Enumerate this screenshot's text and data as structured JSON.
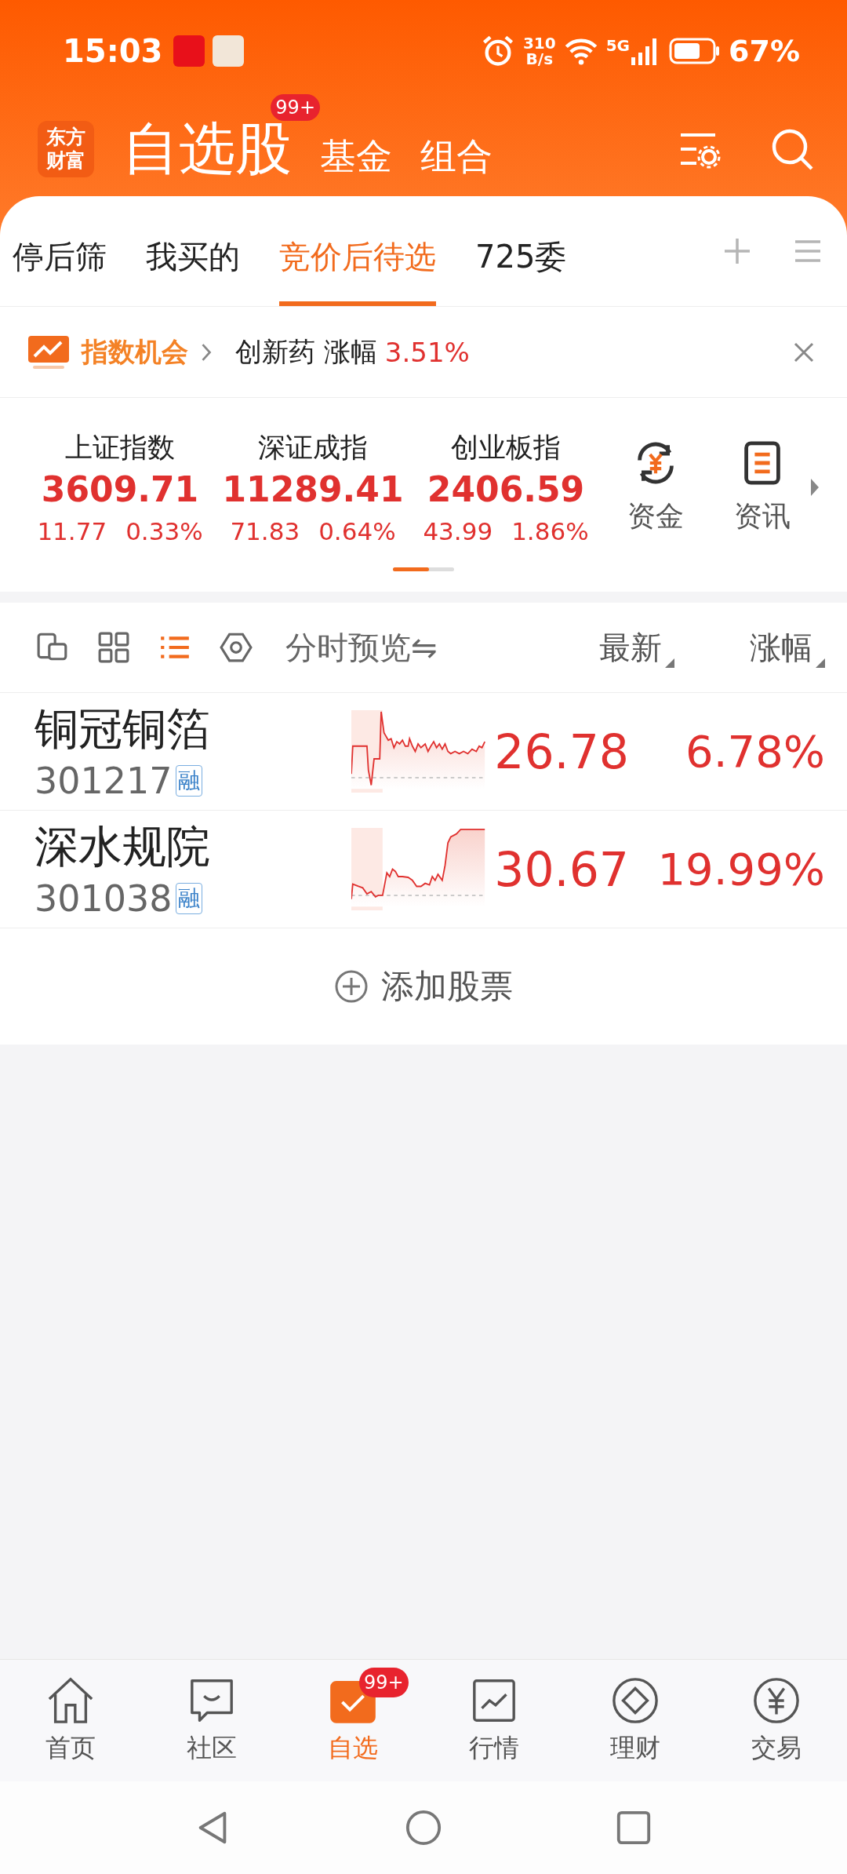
{
  "status_bar": {
    "time": "15:03",
    "net_speed_value": "310",
    "net_speed_unit": "B/s",
    "network": "5G",
    "battery": "67%"
  },
  "header": {
    "logo": [
      "东方",
      "财富"
    ],
    "tabs": [
      {
        "label": "自选股",
        "selected": true,
        "badge": "99+"
      },
      {
        "label": "基金",
        "selected": false
      },
      {
        "label": "组合",
        "selected": false
      }
    ]
  },
  "groups": [
    {
      "label": "停后筛",
      "selected": false
    },
    {
      "label": "我买的",
      "selected": false
    },
    {
      "label": "竞价后待选",
      "selected": true
    },
    {
      "label": "725委",
      "selected": false
    }
  ],
  "banner": {
    "title": "指数机会",
    "text": "创新药 涨幅",
    "value": "3.51%"
  },
  "indices": [
    {
      "name": "上证指数",
      "value": "3609.71",
      "change": "11.77",
      "percent": "0.33%"
    },
    {
      "name": "深证成指",
      "value": "11289.41",
      "change": "71.83",
      "percent": "0.64%"
    },
    {
      "name": "创业板指",
      "value": "2406.59",
      "change": "43.99",
      "percent": "1.86%"
    }
  ],
  "shortcuts": [
    {
      "kind": "funds",
      "label": "资金"
    },
    {
      "kind": "news",
      "label": "资讯"
    }
  ],
  "view_modes": [
    {
      "kind": "switch",
      "selected": false
    },
    {
      "kind": "grid",
      "selected": false
    },
    {
      "kind": "list",
      "selected": true
    },
    {
      "kind": "hex",
      "selected": false
    }
  ],
  "columns": {
    "preview": "分时预览⇋",
    "latest": "最新",
    "change": "涨幅"
  },
  "stocks": [
    {
      "name": "铜冠铜箔",
      "code": "301217",
      "tag": "融",
      "price": "26.78",
      "change": "6.78%"
    },
    {
      "name": "深水规院",
      "code": "301038",
      "tag": "融",
      "price": "30.67",
      "change": "19.99%"
    }
  ],
  "add_stock": "添加股票",
  "bottom_nav": [
    {
      "kind": "home",
      "label": "首页",
      "selected": false
    },
    {
      "kind": "community",
      "label": "社区",
      "selected": false
    },
    {
      "kind": "watchlist",
      "label": "自选",
      "selected": true,
      "badge": "99+"
    },
    {
      "kind": "market",
      "label": "行情",
      "selected": false
    },
    {
      "kind": "wealth",
      "label": "理财",
      "selected": false
    },
    {
      "kind": "trade",
      "label": "交易",
      "selected": false
    }
  ]
}
